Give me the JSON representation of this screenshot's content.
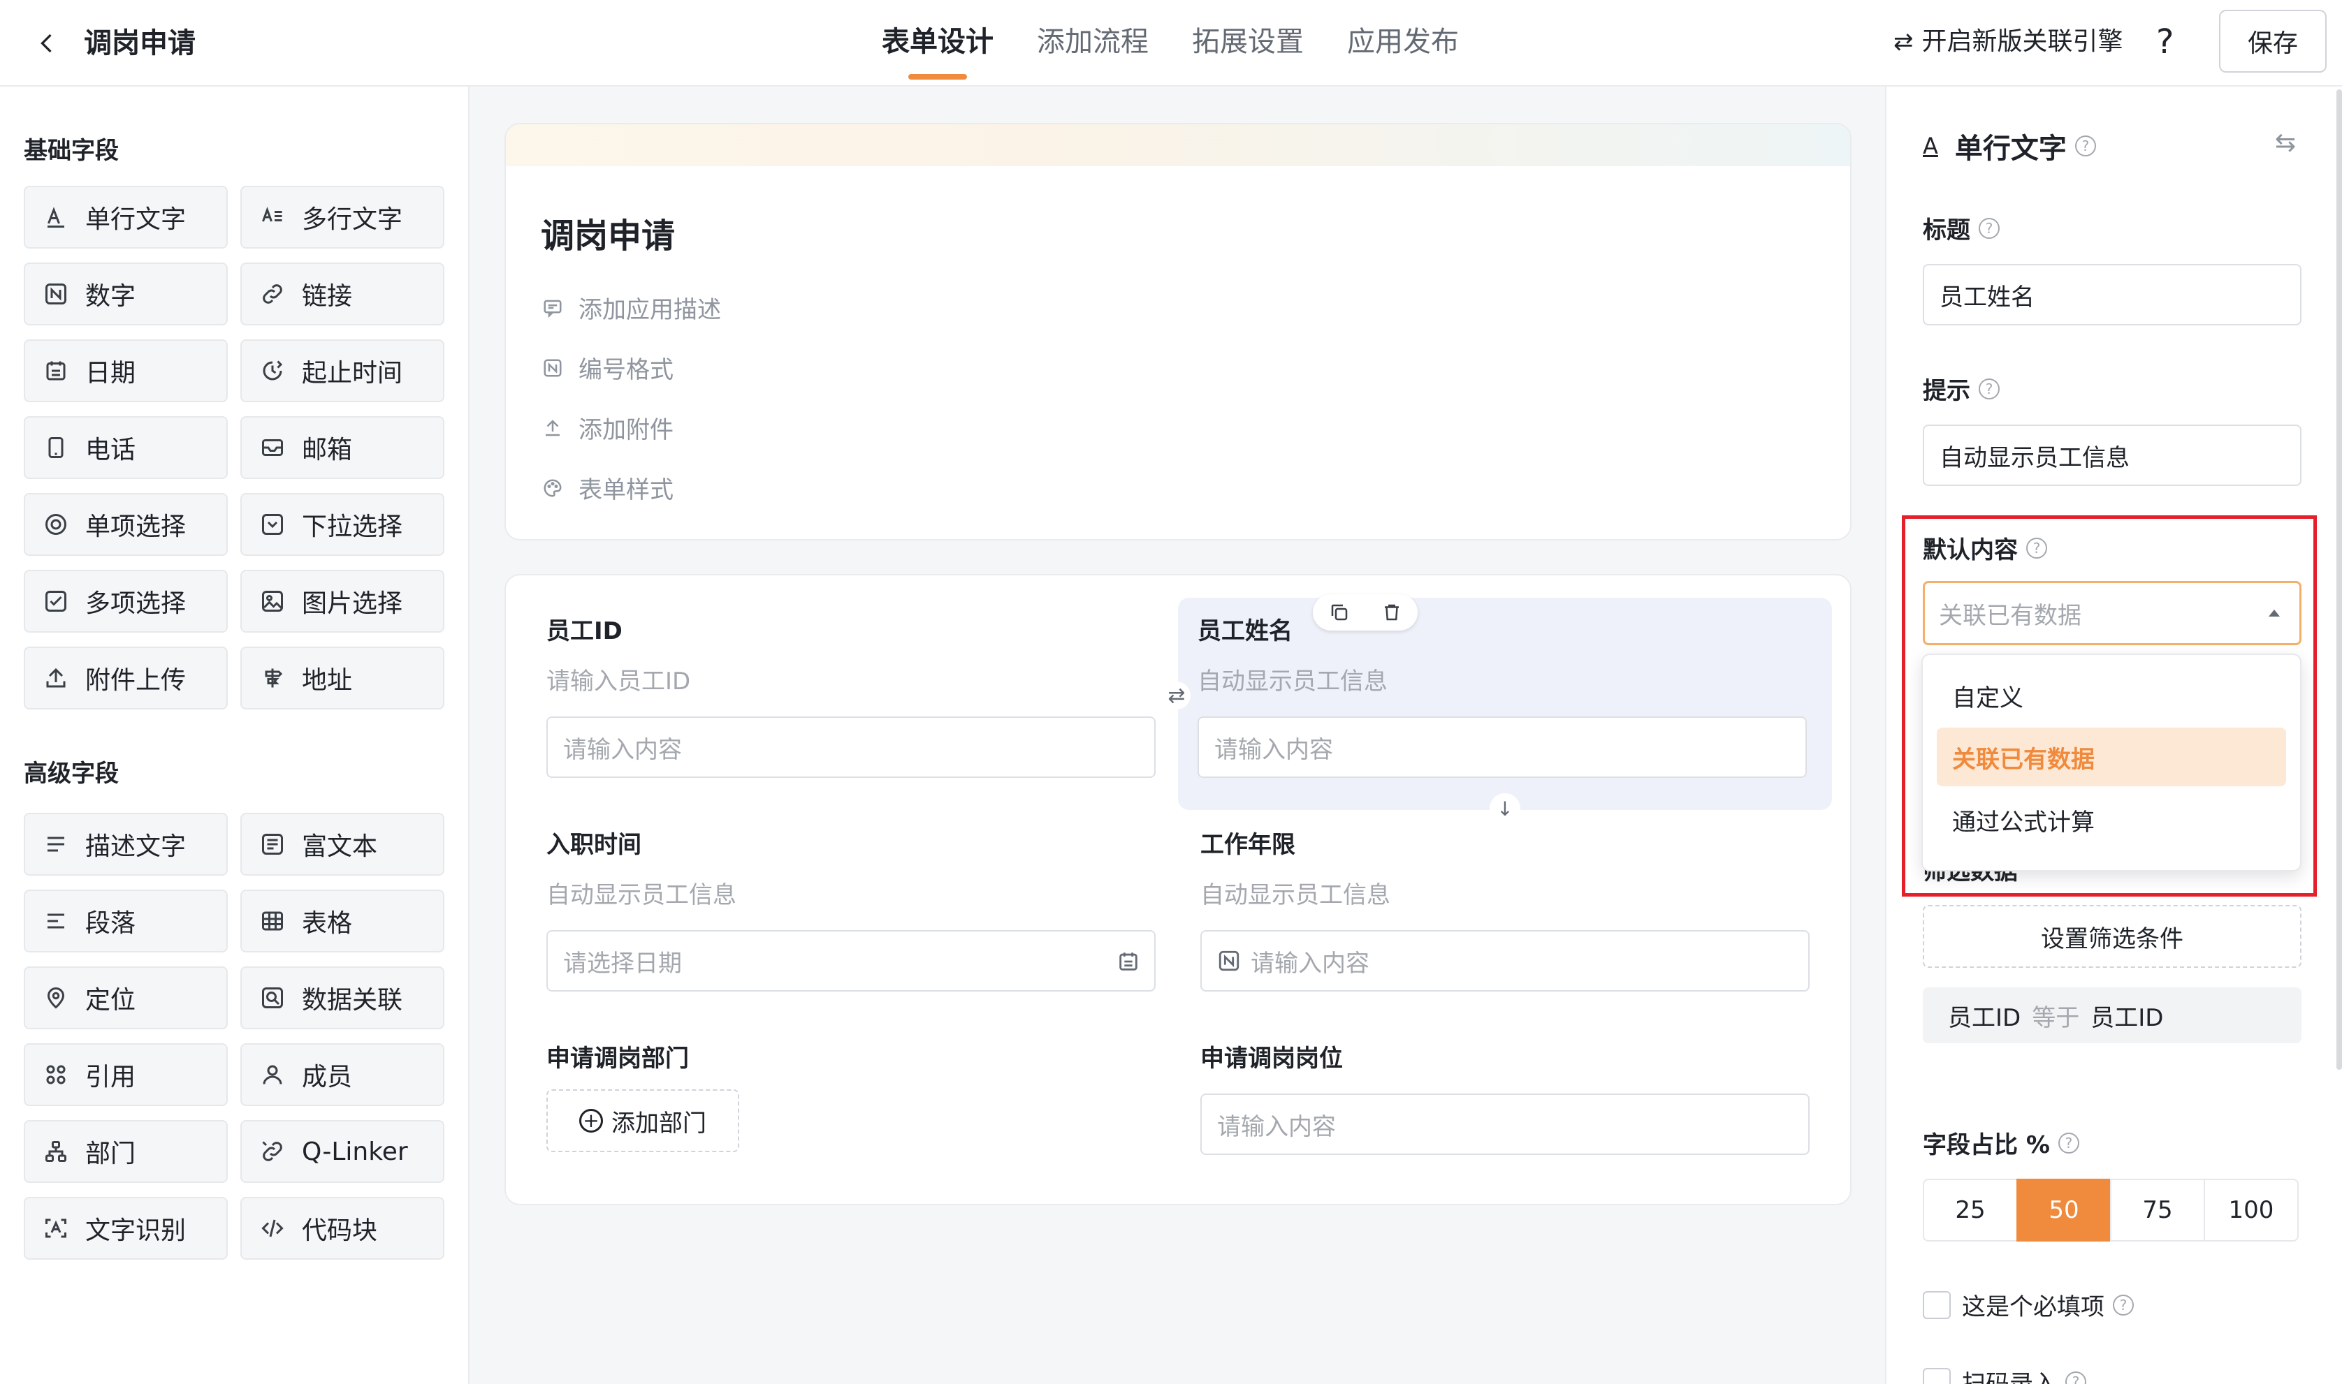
{
  "header": {
    "app_title": "调岗申请",
    "tabs": [
      "表单设计",
      "添加流程",
      "拓展设置",
      "应用发布"
    ],
    "active_tab": "表单设计",
    "engine_label": "开启新版关联引擎",
    "help_label": "?",
    "save_label": "保存"
  },
  "left_panel": {
    "basic_title": "基础字段",
    "basic_fields": [
      {
        "label": "单行文字",
        "icon": "single-line-text-icon"
      },
      {
        "label": "多行文字",
        "icon": "multi-line-text-icon"
      },
      {
        "label": "数字",
        "icon": "number-icon"
      },
      {
        "label": "链接",
        "icon": "link-icon"
      },
      {
        "label": "日期",
        "icon": "calendar-icon"
      },
      {
        "label": "起止时间",
        "icon": "time-range-icon"
      },
      {
        "label": "电话",
        "icon": "phone-icon"
      },
      {
        "label": "邮箱",
        "icon": "mail-icon"
      },
      {
        "label": "单项选择",
        "icon": "radio-icon"
      },
      {
        "label": "下拉选择",
        "icon": "dropdown-icon"
      },
      {
        "label": "多项选择",
        "icon": "checkbox-icon"
      },
      {
        "label": "图片选择",
        "icon": "image-icon"
      },
      {
        "label": "附件上传",
        "icon": "upload-icon"
      },
      {
        "label": "地址",
        "icon": "signpost-icon"
      }
    ],
    "advanced_title": "高级字段",
    "advanced_fields": [
      {
        "label": "描述文字",
        "icon": "description-icon"
      },
      {
        "label": "富文本",
        "icon": "rich-text-icon"
      },
      {
        "label": "段落",
        "icon": "paragraph-icon"
      },
      {
        "label": "表格",
        "icon": "table-icon"
      },
      {
        "label": "定位",
        "icon": "location-icon"
      },
      {
        "label": "数据关联",
        "icon": "data-link-icon"
      },
      {
        "label": "引用",
        "icon": "reference-icon"
      },
      {
        "label": "成员",
        "icon": "member-icon"
      },
      {
        "label": "部门",
        "icon": "department-icon"
      },
      {
        "label": "Q-Linker",
        "icon": "qlinker-icon"
      },
      {
        "label": "文字识别",
        "icon": "ocr-icon"
      },
      {
        "label": "代码块",
        "icon": "code-icon"
      }
    ]
  },
  "form_header": {
    "title": "调岗申请",
    "actions": [
      {
        "label": "添加应用描述",
        "icon": "comment-icon"
      },
      {
        "label": "编号格式",
        "icon": "number-format-icon"
      },
      {
        "label": "添加附件",
        "icon": "attachment-upload-icon"
      },
      {
        "label": "表单样式",
        "icon": "palette-icon"
      }
    ]
  },
  "form_fields": {
    "employee_id": {
      "label": "员工ID",
      "hint": "请输入员工ID",
      "placeholder": "请输入内容"
    },
    "employee_name": {
      "label": "员工姓名",
      "hint": "自动显示员工信息",
      "placeholder": "请输入内容"
    },
    "hire_date": {
      "label": "入职时间",
      "hint": "自动显示员工信息",
      "placeholder": "请选择日期"
    },
    "work_years": {
      "label": "工作年限",
      "hint": "自动显示员工信息",
      "placeholder": "请输入内容"
    },
    "dept": {
      "label": "申请调岗部门",
      "button": "添加部门"
    },
    "position": {
      "label": "申请调岗岗位",
      "placeholder": "请输入内容"
    }
  },
  "properties": {
    "field_type": "单行文字",
    "title_label": "标题",
    "title_value": "员工姓名",
    "hint_label": "提示",
    "hint_value": "自动显示员工信息",
    "default_label": "默认内容",
    "default_value": "关联已有数据",
    "default_options": [
      "自定义",
      "关联已有数据",
      "通过公式计算"
    ],
    "selected_option": "关联已有数据",
    "filter_label": "筛选数据",
    "filter_button": "设置筛选条件",
    "condition": {
      "left": "员工ID",
      "op": "等于",
      "right": "员工ID"
    },
    "width_label": "字段占比 %",
    "width_options": [
      "25",
      "50",
      "75",
      "100"
    ],
    "width_selected": "50",
    "required_label": "这是个必填项",
    "scan_label": "扫码录入"
  },
  "colors": {
    "accent": "#f08a3c",
    "highlight_box": "#e5202b"
  }
}
